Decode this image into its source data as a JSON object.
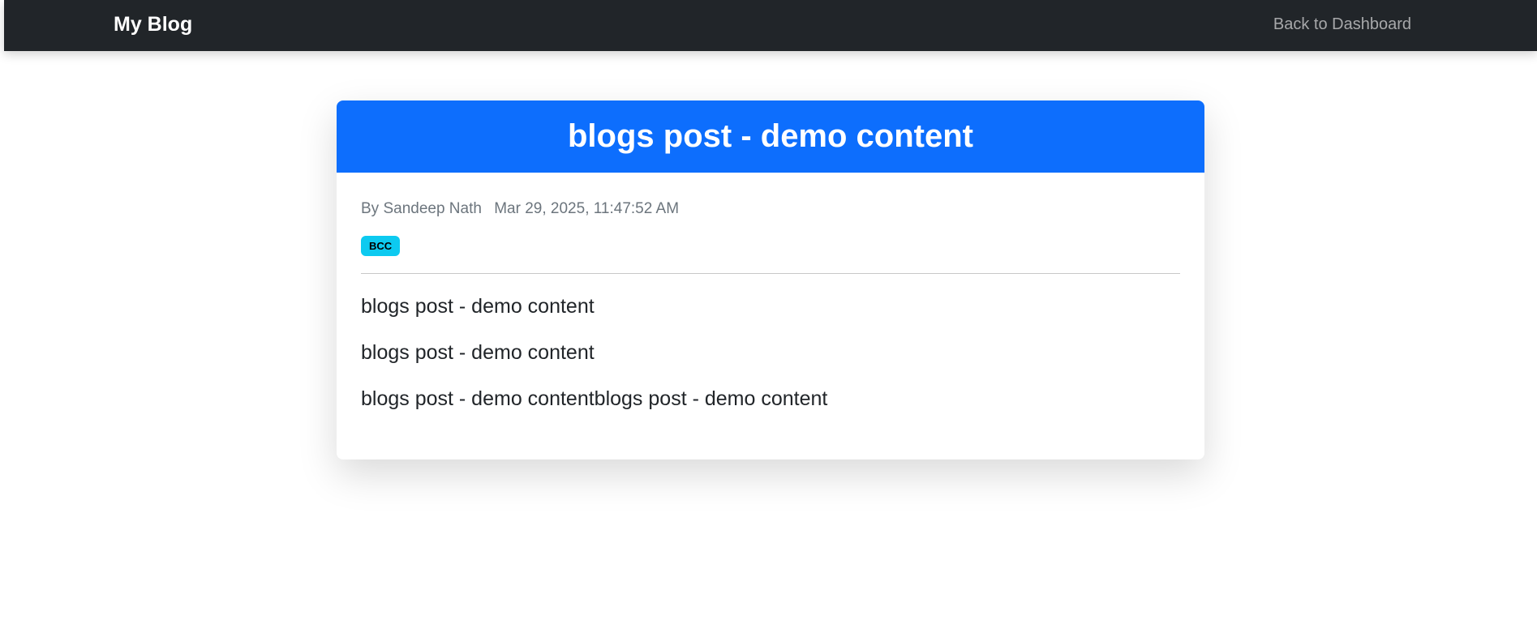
{
  "navbar": {
    "brand": "My Blog",
    "back_link": "Back to Dashboard"
  },
  "post": {
    "title": "blogs post - demo content",
    "author": "By Sandeep Nath",
    "date": "Mar 29, 2025, 11:47:52 AM",
    "tag": "BCC",
    "paragraphs": [
      "blogs post - demo content",
      "blogs post - demo content",
      "blogs post - demo contentblogs post - demo content"
    ]
  },
  "colors": {
    "navbar_bg": "#212529",
    "header_bg": "#0d6efd",
    "badge_bg": "#0dcaf0"
  }
}
